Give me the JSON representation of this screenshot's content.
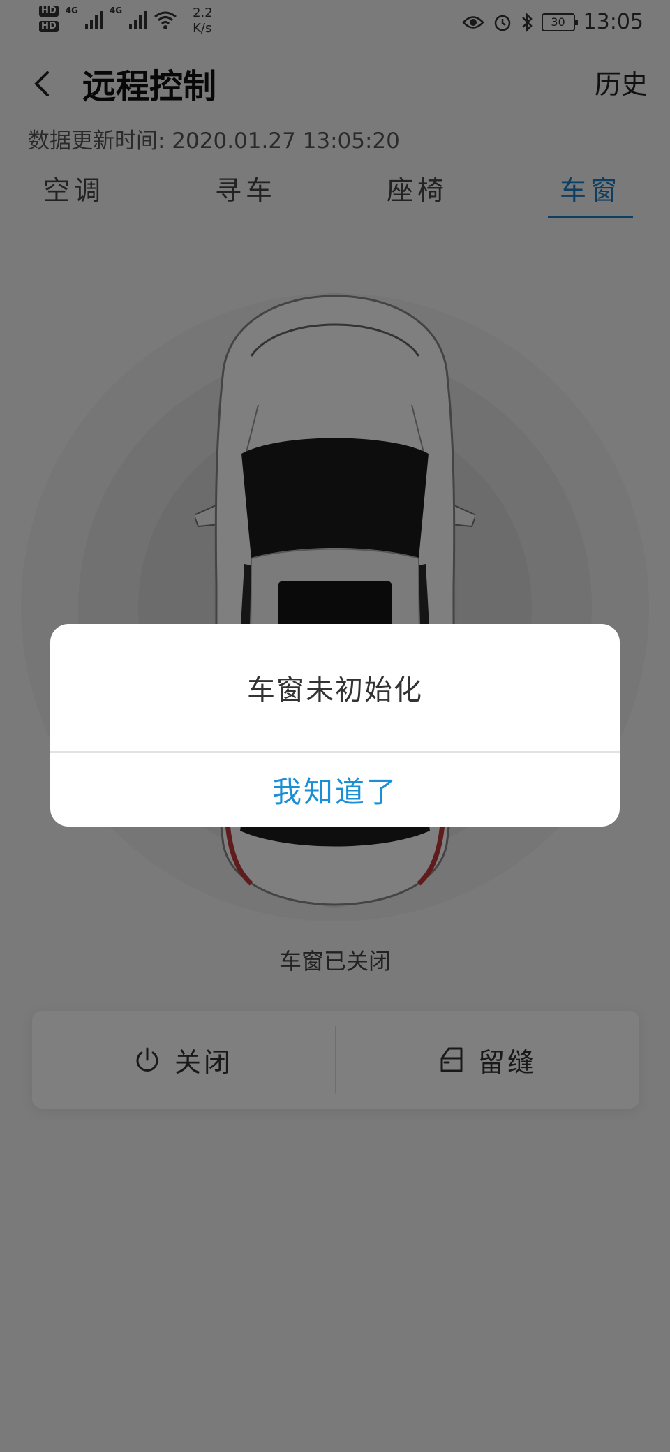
{
  "status_bar": {
    "hd1": "HD",
    "hd2": "HD",
    "net1": "4G",
    "net2": "4G",
    "speed_value": "2.2",
    "speed_unit": "K/s",
    "battery": "30",
    "time": "13:05",
    "icons": [
      "eye-comfort-icon",
      "alarm-icon",
      "bluetooth-icon"
    ]
  },
  "header": {
    "back_icon": "chevron-left-icon",
    "title": "远程控制",
    "history": "历史"
  },
  "updated": "数据更新时间: 2020.01.27 13:05:20",
  "tabs": [
    {
      "label": "空调"
    },
    {
      "label": "寻车"
    },
    {
      "label": "座椅"
    },
    {
      "label": "车窗"
    }
  ],
  "active_tab": "车窗",
  "window_status": "车窗已关闭",
  "controls": {
    "close_label": "关闭",
    "close_icon": "power-icon",
    "vent_label": "留缝",
    "vent_icon": "car-door-icon"
  },
  "dialog": {
    "message": "车窗未初始化",
    "button": "我知道了"
  },
  "colors": {
    "accent": "#1a7fc4",
    "dialog_button": "#1a8fd6",
    "background": "#f4f4f4"
  }
}
